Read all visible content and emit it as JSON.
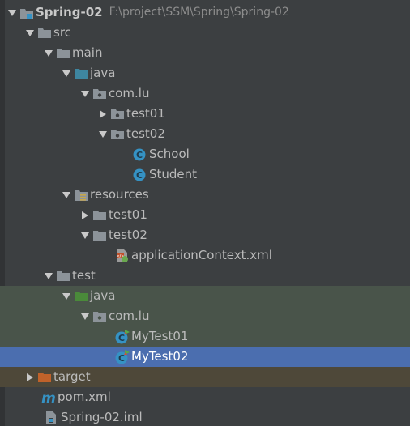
{
  "colors": {
    "background": "#3c3f41",
    "test_row_bg": "#49544a",
    "selected_row_bg": "#4b6eaf",
    "excluded_row_bg": "#4e4839",
    "folder_gray": "#8c9399",
    "source_root_blue": "#3e86a0",
    "test_root_green": "#4a8a3a",
    "excluded_orange": "#c0622a",
    "class_icon_blue": "#3592c4"
  },
  "project": {
    "name": "Spring-02",
    "path": "F:\\project\\SSM\\Spring\\Spring-02"
  },
  "tree": {
    "src": "src",
    "main": "main",
    "main_java": "java",
    "main_pkg": "com.lu",
    "test01_pkg": "test01",
    "test02_pkg": "test02",
    "school": "School",
    "student": "Student",
    "resources": "resources",
    "res_test01": "test01",
    "res_test02": "test02",
    "app_context": "applicationContext.xml",
    "test": "test",
    "test_java": "java",
    "test_pkg": "com.lu",
    "mytest01": "MyTest01",
    "mytest02": "MyTest02",
    "target": "target",
    "pom": "pom.xml",
    "iml": "Spring-02.iml"
  },
  "icons": {
    "expanded": "triangle-down-icon",
    "collapsed": "triangle-right-icon",
    "module": "module-folder-icon",
    "folder": "folder-icon",
    "source_root": "source-root-folder-icon",
    "package": "package-icon",
    "class": "class-icon",
    "resources_root": "resources-root-icon",
    "xml": "spring-xml-icon",
    "test_root": "test-root-folder-icon",
    "test_class": "test-class-icon",
    "excluded": "excluded-folder-icon",
    "maven": "maven-icon",
    "iml": "iml-file-icon"
  }
}
